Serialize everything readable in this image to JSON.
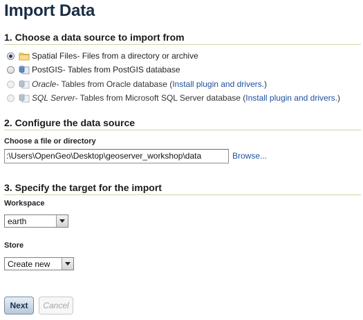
{
  "page": {
    "title": "Import Data"
  },
  "section1": {
    "heading": "1. Choose a data source to import from",
    "sources": [
      {
        "name": "Spatial Files",
        "desc": " - Files from a directory or archive",
        "selected": true,
        "enabled": true,
        "icon": "folder-icon"
      },
      {
        "name": "PostGIS",
        "desc": " - Tables from PostGIS database",
        "selected": false,
        "enabled": true,
        "icon": "database-icon"
      },
      {
        "name": "Oracle",
        "desc": " - Tables from Oracle database (",
        "link": "Install plugin and drivers.",
        "close": ")",
        "selected": false,
        "enabled": false,
        "icon": "database-icon"
      },
      {
        "name": "SQL Server",
        "desc": " - Tables from Microsoft SQL Server database (",
        "link": "Install plugin and drivers.",
        "close": ")",
        "selected": false,
        "enabled": false,
        "icon": "database-icon"
      }
    ]
  },
  "section2": {
    "heading": "2. Configure the data source",
    "file_label": "Choose a file or directory",
    "file_value": ":\\Users\\OpenGeo\\Desktop\\geoserver_workshop\\data",
    "browse": "Browse..."
  },
  "section3": {
    "heading": "3. Specify the target for the import",
    "workspace_label": "Workspace",
    "workspace_value": "earth",
    "store_label": "Store",
    "store_value": "Create new"
  },
  "actions": {
    "next": "Next",
    "cancel": "Cancel"
  },
  "colors": {
    "title": "#1a2d45",
    "link": "#1e4fa0",
    "rule": "#c9d6a6"
  }
}
